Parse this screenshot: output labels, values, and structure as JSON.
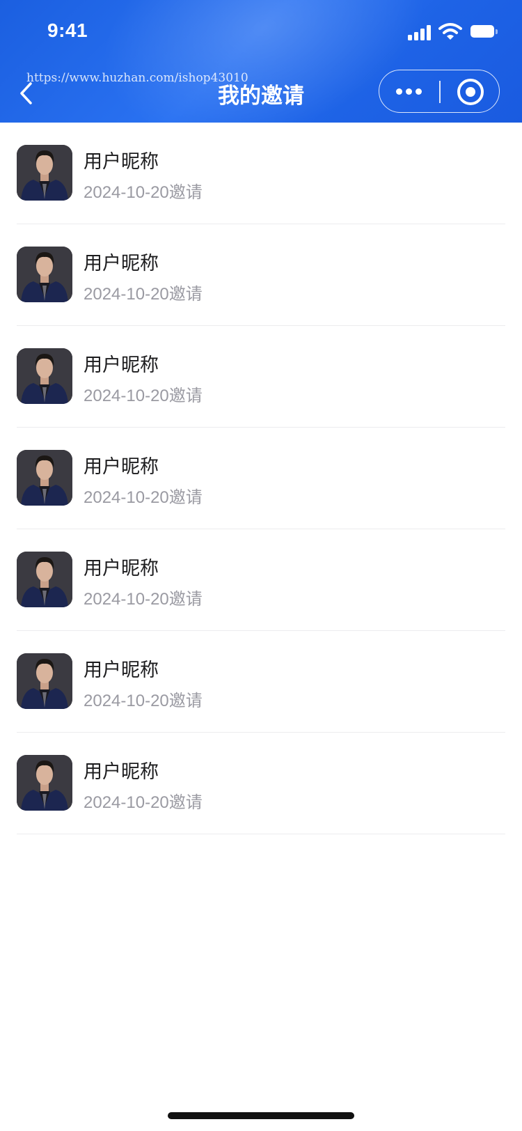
{
  "status_bar": {
    "time": "9:41"
  },
  "watermark": "https://www.huzhan.com/ishop43010",
  "header": {
    "title": "我的邀请"
  },
  "invites": [
    {
      "name": "用户昵称",
      "date": "2024-10-20邀请"
    },
    {
      "name": "用户昵称",
      "date": "2024-10-20邀请"
    },
    {
      "name": "用户昵称",
      "date": "2024-10-20邀请"
    },
    {
      "name": "用户昵称",
      "date": "2024-10-20邀请"
    },
    {
      "name": "用户昵称",
      "date": "2024-10-20邀请"
    },
    {
      "name": "用户昵称",
      "date": "2024-10-20邀请"
    },
    {
      "name": "用户昵称",
      "date": "2024-10-20邀请"
    }
  ],
  "icons": {
    "back": "back-chevron-icon",
    "more": "more-dots-icon",
    "close": "close-miniprogram-icon",
    "signal": "signal-icon",
    "wifi": "wifi-icon",
    "battery": "battery-icon"
  },
  "colors": {
    "header": "#2266e8",
    "title": "#1c1c1e",
    "subtitle": "#9a9aa2",
    "divider": "#ececee"
  }
}
